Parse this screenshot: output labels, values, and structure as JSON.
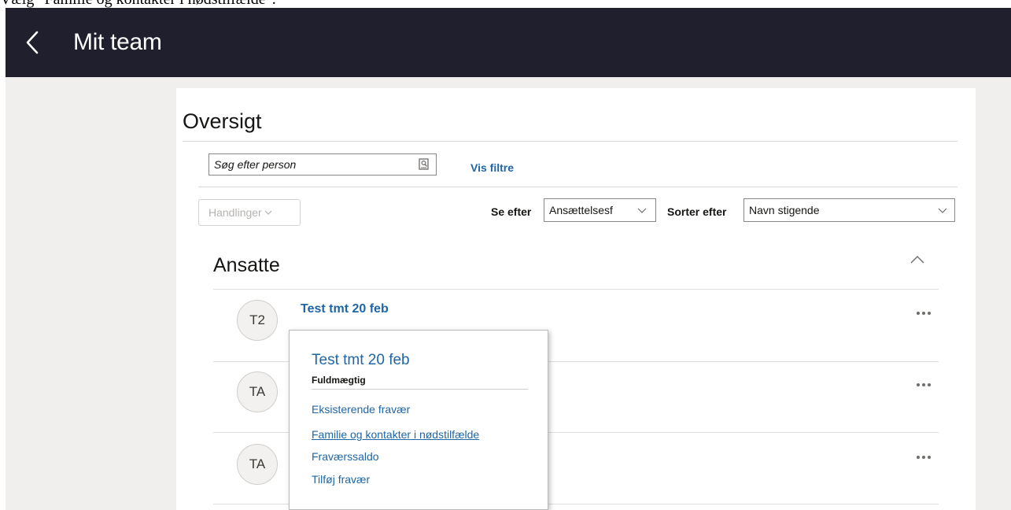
{
  "instruction": "Vælg \"Familie og kontakter i nødstilfælde\".",
  "header": {
    "title": "Mit team"
  },
  "overview": {
    "title": "Oversigt",
    "search": {
      "placeholder": "Søg efter person",
      "value": ""
    },
    "filters_link": "Vis filtre",
    "actions_label": "Handlinger",
    "view_label": "Se efter",
    "view_value": "Ansættelsesf",
    "sort_label": "Sorter efter",
    "sort_value": "Navn stigende"
  },
  "section": {
    "title": "Ansatte",
    "employees": [
      {
        "initials": "T2",
        "name": "Test tmt 20 feb"
      },
      {
        "initials": "TA",
        "name": ""
      },
      {
        "initials": "TA",
        "name": ""
      }
    ]
  },
  "popup": {
    "name": "Test tmt 20 feb",
    "title": "Fuldmægtig",
    "links": [
      "Eksisterende fravær",
      "Familie og kontakter i nødstilfælde",
      "Fraværssaldo",
      "Tilføj fravær"
    ]
  },
  "colors": {
    "header_bg": "#201f2e",
    "link": "#2066a6",
    "page_bg": "#f1efed"
  }
}
